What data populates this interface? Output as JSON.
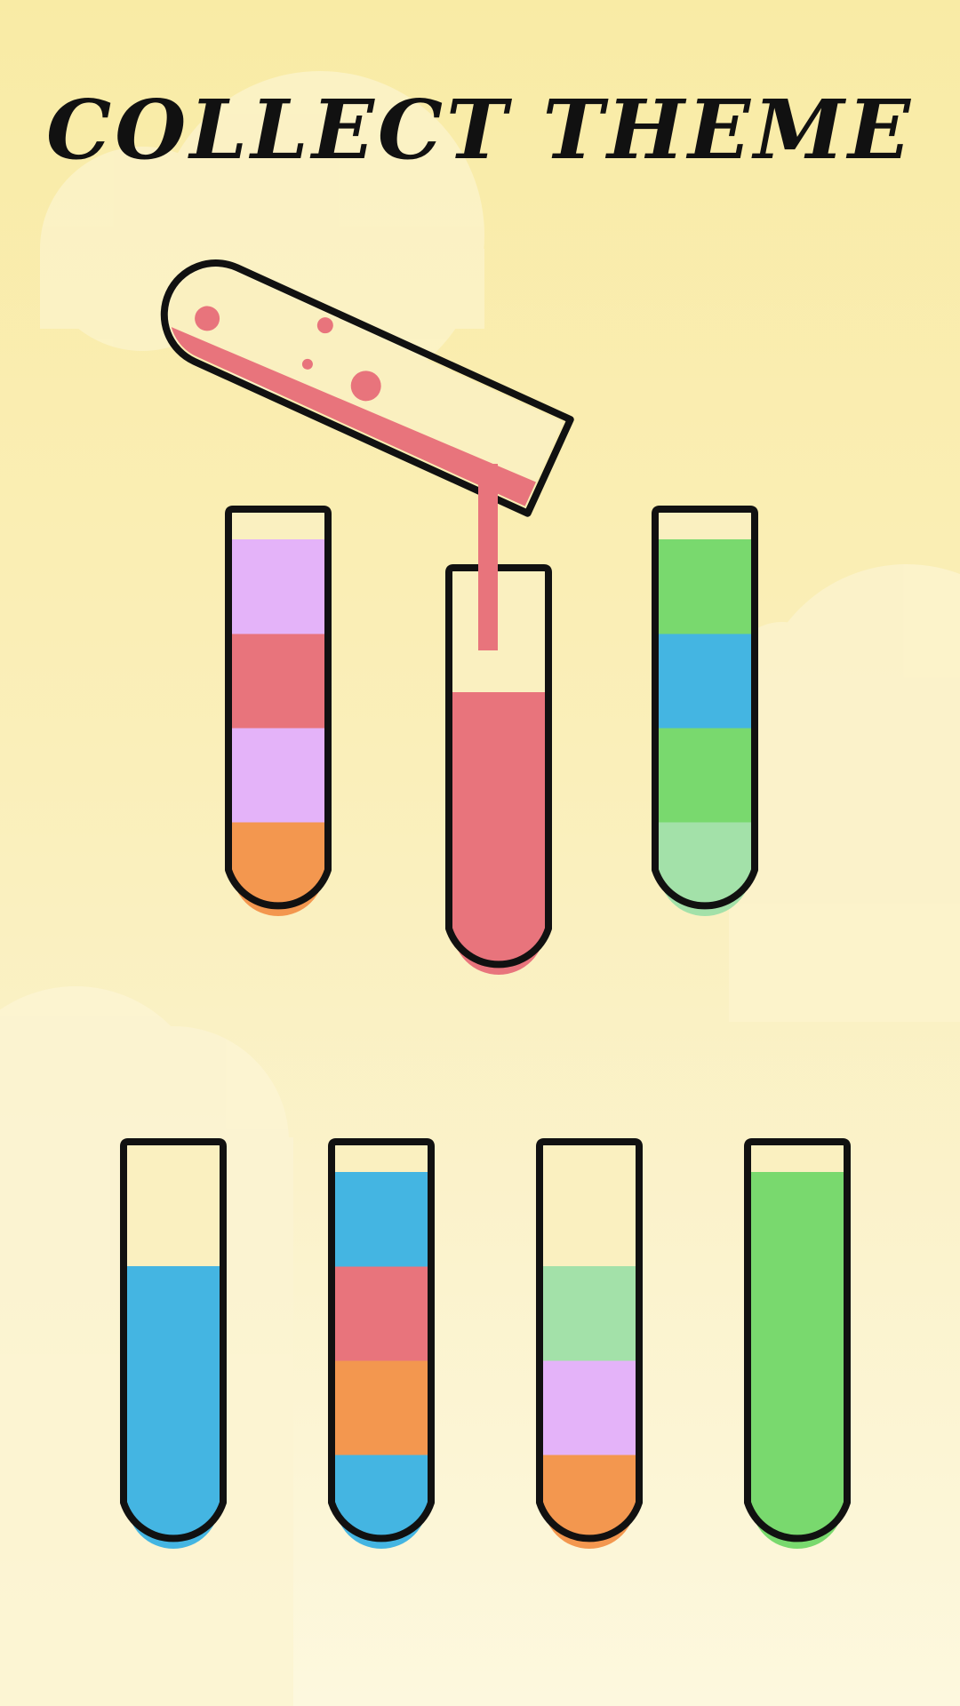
{
  "title": "COLLECT THEME",
  "colors": {
    "background_top": "#f9eba5",
    "background_bottom": "#fdf8de",
    "outline": "#111111",
    "glass": "#faf0c0",
    "pink": "#e8747c",
    "lavender": "#e4b3f9",
    "orange": "#f3974f",
    "green": "#79d96e",
    "blue": "#44b5e2",
    "mint": "#a3e1a9"
  },
  "tubes": [
    {
      "id": "tube-1",
      "capacity": 4,
      "layers_bottom_to_top": [
        "orange",
        "lavender",
        "pink",
        "lavender"
      ]
    },
    {
      "id": "tube-2",
      "capacity": 4,
      "layers_bottom_to_top": [
        "pink",
        "pink",
        "pink"
      ],
      "receiving_pour": true
    },
    {
      "id": "tube-3",
      "capacity": 4,
      "layers_bottom_to_top": [
        "mint",
        "green",
        "blue",
        "green"
      ]
    },
    {
      "id": "tube-4",
      "capacity": 4,
      "layers_bottom_to_top": [
        "blue",
        "blue",
        "blue"
      ]
    },
    {
      "id": "tube-5",
      "capacity": 4,
      "layers_bottom_to_top": [
        "blue",
        "orange",
        "pink",
        "blue"
      ]
    },
    {
      "id": "tube-6",
      "capacity": 4,
      "layers_bottom_to_top": [
        "orange",
        "lavender",
        "mint"
      ]
    },
    {
      "id": "tube-7",
      "capacity": 4,
      "layers_bottom_to_top": [
        "green",
        "green",
        "green",
        "green"
      ]
    }
  ],
  "pouring_tube": {
    "id": "pouring-tube",
    "liquid_color": "pink",
    "state": "pouring"
  }
}
